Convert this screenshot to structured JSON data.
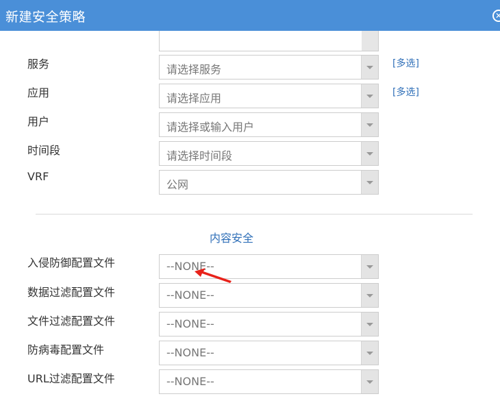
{
  "dialog": {
    "title": "新建安全策略",
    "close_icon": "close-circle-icon"
  },
  "fields": [
    {
      "id": "service",
      "label": "服务",
      "value": "请选择服务",
      "multi": "[多选]"
    },
    {
      "id": "application",
      "label": "应用",
      "value": "请选择应用",
      "multi": "[多选]"
    },
    {
      "id": "user",
      "label": "用户",
      "value": "请选择或输入用户",
      "multi": ""
    },
    {
      "id": "time-range",
      "label": "时间段",
      "value": "请选择时间段",
      "multi": ""
    },
    {
      "id": "vrf",
      "label": "VRF",
      "value": "公网",
      "multi": ""
    }
  ],
  "content_security": {
    "title": "内容安全",
    "fields": [
      {
        "id": "ips-profile",
        "label": "入侵防御配置文件",
        "value": "--NONE--"
      },
      {
        "id": "data-filter-profile",
        "label": "数据过滤配置文件",
        "value": "--NONE--"
      },
      {
        "id": "file-filter-profile",
        "label": "文件过滤配置文件",
        "value": "--NONE--"
      },
      {
        "id": "antivirus-profile",
        "label": "防病毒配置文件",
        "value": "--NONE--"
      },
      {
        "id": "url-filter-profile",
        "label": "URL过滤配置文件",
        "value": "--NONE--"
      }
    ]
  },
  "colors": {
    "titlebar": "#4a8fd8",
    "link": "#2f6fb8",
    "annotation_arrow": "#e8221a"
  }
}
